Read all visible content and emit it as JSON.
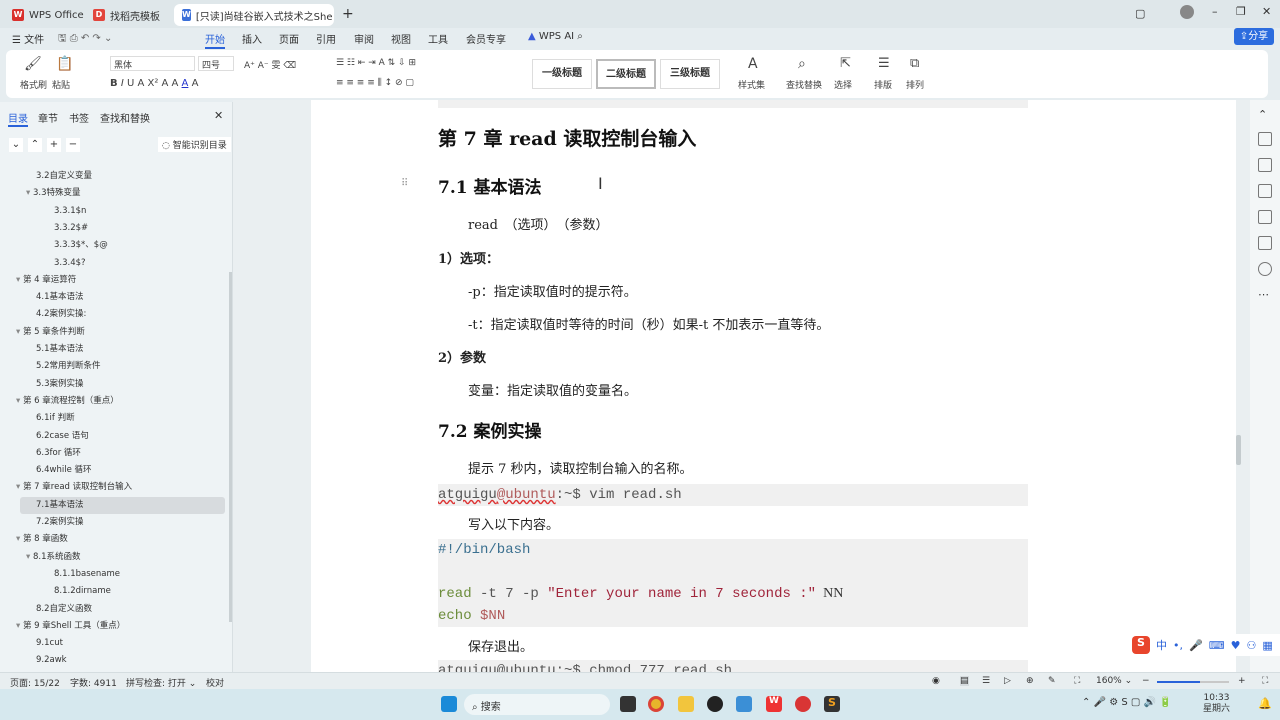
{
  "tabs": [
    {
      "label": "WPS Office"
    },
    {
      "label": "找稻壳模板"
    },
    {
      "label": "[只读]尚硅谷嵌入式技术之She"
    }
  ],
  "menu": {
    "file": "文件",
    "items": [
      "开始",
      "插入",
      "页面",
      "引用",
      "审阅",
      "视图",
      "工具",
      "会员专享"
    ],
    "ai": "WPS AI",
    "share": "分享"
  },
  "ribbon": {
    "format_painter": "格式刷",
    "paste": "粘贴",
    "font": "黑体",
    "size": "四号",
    "styles": [
      "一级标题",
      "二级标题",
      "三级标题"
    ],
    "style_set": "样式集",
    "find_replace": "查找替换",
    "select": "选择",
    "layout": "排版",
    "arrange": "排列"
  },
  "nav": {
    "tabs": [
      "目录",
      "章节",
      "书签",
      "查找和替换"
    ],
    "smart": "智能识别目录",
    "items": [
      {
        "label": "3.2自定义变量",
        "level": 2
      },
      {
        "label": "3.3特殊变量",
        "level": 2,
        "arrow": true
      },
      {
        "label": "3.3.1$n",
        "level": 3
      },
      {
        "label": "3.3.2$#",
        "level": 3
      },
      {
        "label": "3.3.3$*、$@",
        "level": 3
      },
      {
        "label": "3.3.4$?",
        "level": 3
      },
      {
        "label": "第 4 章运算符",
        "level": 1,
        "arrow": true
      },
      {
        "label": "4.1基本语法",
        "level": 2
      },
      {
        "label": "4.2案例实操:",
        "level": 2
      },
      {
        "label": "第 5 章条件判断",
        "level": 1,
        "arrow": true
      },
      {
        "label": "5.1基本语法",
        "level": 2
      },
      {
        "label": "5.2常用判断条件",
        "level": 2
      },
      {
        "label": "5.3案例实操",
        "level": 2
      },
      {
        "label": "第 6 章流程控制（重点）",
        "level": 1,
        "arrow": true
      },
      {
        "label": "6.1if 判断",
        "level": 2
      },
      {
        "label": "6.2case 语句",
        "level": 2
      },
      {
        "label": "6.3for 循环",
        "level": 2
      },
      {
        "label": "6.4while 循环",
        "level": 2
      },
      {
        "label": "第 7 章read 读取控制台输入",
        "level": 1,
        "arrow": true
      },
      {
        "label": "7.1基本语法",
        "level": 2,
        "selected": true
      },
      {
        "label": "7.2案例实操",
        "level": 2
      },
      {
        "label": "第 8 章函数",
        "level": 1,
        "arrow": true
      },
      {
        "label": "8.1系统函数",
        "level": 2,
        "arrow": true
      },
      {
        "label": "8.1.1basename",
        "level": 3
      },
      {
        "label": "8.1.2dirname",
        "level": 3
      },
      {
        "label": "8.2自定义函数",
        "level": 2
      },
      {
        "label": "第 9 章Shell 工具（重点）",
        "level": 1,
        "arrow": true
      },
      {
        "label": "9.1cut",
        "level": 2
      },
      {
        "label": "9.2awk",
        "level": 2
      }
    ]
  },
  "doc": {
    "h1": "第 7 章  read 读取控制台输入",
    "h2a": "7.1  基本语法",
    "syntax": "read　（选项）　（参数）",
    "opt_title": "1）选项：",
    "opt_p": "-p：指定读取值时的提示符。",
    "opt_t": "-t：指定读取值时等待的时间（秒）如果-t 不加表示一直等待。",
    "param_title": "2）参数",
    "param_var": "变量：指定读取值的变量名。",
    "h2b": "7.2  案例实操",
    "task": "提示 7 秒内，读取控制台输入的名称。",
    "cmd1_user": "atguigu",
    "cmd1_host": "@ubuntu",
    "cmd1_rest": ":~$ vim read.sh",
    "write": "写入以下内容。",
    "shebang": "#!/bin/bash",
    "read_kw": "read",
    "read_args": " -t 7 -p ",
    "read_str": "\"Enter your name in 7 seconds :\"",
    "read_var": "  NN",
    "echo_kw": "echo",
    "echo_var": " $NN",
    "save": "保存退出。",
    "cmd2": "atguigu@ubuntu:~$ chmod 777 read.sh"
  },
  "status": {
    "page": "页面: 15/22",
    "words": "字数: 4911",
    "spell": "拼写检查: 打开",
    "proof": "校对",
    "zoom": "160%",
    "zoom_fraction": 0.6
  },
  "taskbar": {
    "search": "搜索",
    "time": "10:33",
    "day": "星期六"
  },
  "ime": {
    "mode": "中"
  }
}
